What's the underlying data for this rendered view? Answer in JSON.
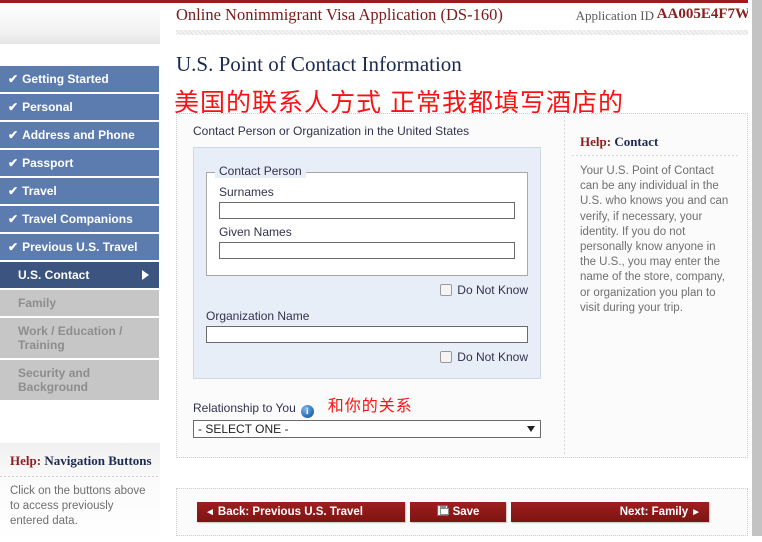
{
  "header": {
    "title": "Online Nonimmigrant Visa Application (DS-160)",
    "app_id_label": "Application ID",
    "app_id_value": "AA005E4F7W"
  },
  "page": {
    "heading": "U.S. Point of Contact Information",
    "annotation_cn": "美国的联系人方式  正常我都填写酒店的"
  },
  "sidebar": {
    "items": [
      {
        "label": "Getting Started",
        "state": "complete",
        "check": "✔"
      },
      {
        "label": "Personal",
        "state": "complete",
        "check": "✔"
      },
      {
        "label": "Address and Phone",
        "state": "complete",
        "check": "✔"
      },
      {
        "label": "Passport",
        "state": "complete",
        "check": "✔"
      },
      {
        "label": "Travel",
        "state": "complete",
        "check": "✔"
      },
      {
        "label": "Travel Companions",
        "state": "complete",
        "check": "✔"
      },
      {
        "label": "Previous U.S. Travel",
        "state": "complete",
        "check": "✔"
      },
      {
        "label": "U.S. Contact",
        "state": "active",
        "check": ""
      },
      {
        "label": "Family",
        "state": "disabled",
        "check": ""
      },
      {
        "label": "Work / Education / Training",
        "state": "disabled",
        "check": ""
      },
      {
        "label": "Security and Background",
        "state": "disabled",
        "check": ""
      }
    ],
    "help": {
      "title_hl": "Help:",
      "title_rest": " Navigation Buttons",
      "body": "Click on the buttons above to access previously entered data."
    }
  },
  "form": {
    "legend": "Contact Person or Organization in the United States",
    "contact_person_legend": "Contact Person",
    "surnames_label": "Surnames",
    "surnames_value": "",
    "given_names_label": "Given Names",
    "given_names_value": "",
    "do_not_know_1": "Do Not Know",
    "organization_label": "Organization Name",
    "organization_value": "",
    "do_not_know_2": "Do Not Know",
    "relationship_label": "Relationship to You",
    "relationship_annotation_cn": "和你的关系",
    "relationship_selected": "- SELECT ONE -",
    "info_glyph": "i"
  },
  "right_help": {
    "title_hl": "Help:",
    "title_rest": " Contact",
    "body": "Your U.S. Point of Contact can be any individual in the U.S. who knows you and can verify, if necessary, your identity. If you do not personally know anyone in the U.S., you may enter the name of the store, company, or organization you plan to visit during your trip."
  },
  "buttons": {
    "back": "Back: Previous U.S. Travel",
    "back_caret": "◄",
    "save": "Save",
    "next": "Next: Family",
    "next_caret": "►"
  },
  "colors": {
    "brand_red": "#8a1f1f",
    "nav_blue": "#5c7cb0",
    "nav_active": "#3c5580",
    "nav_disabled": "#c6c6c6",
    "annotation_red": "#fb1111",
    "panel_blue": "#e8eef7"
  }
}
